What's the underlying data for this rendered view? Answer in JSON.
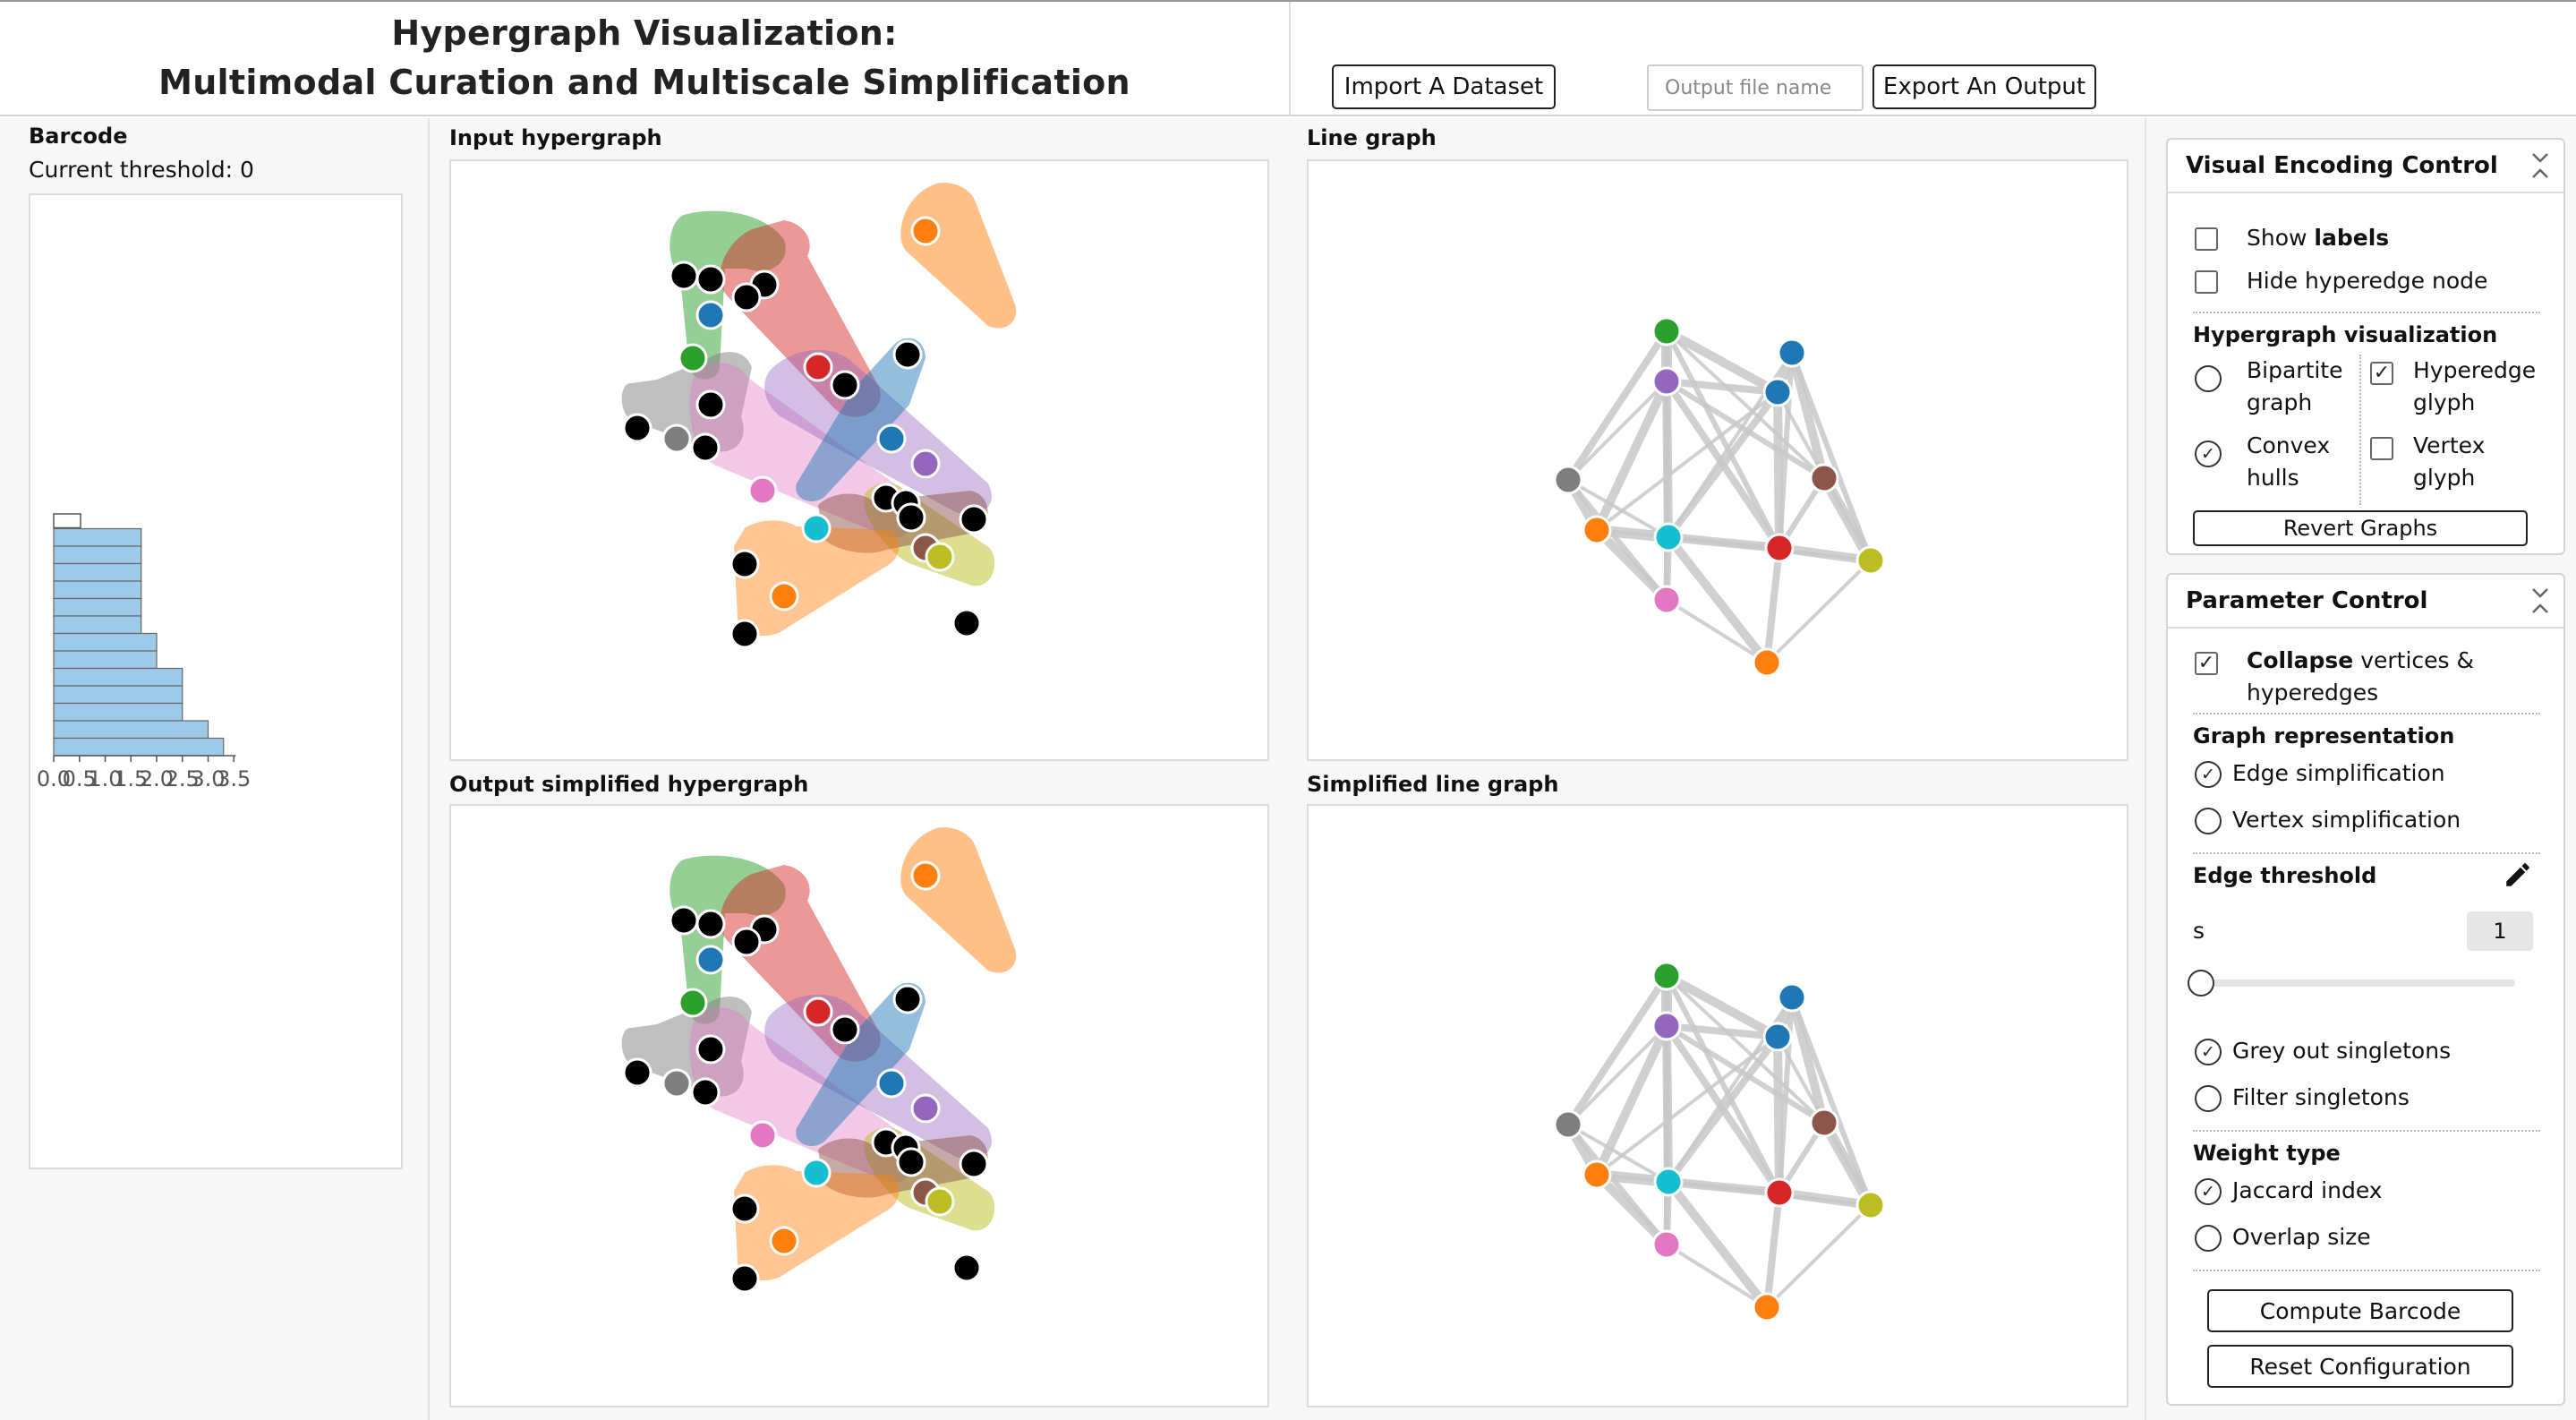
{
  "header": {
    "title_line1": "Hypergraph Visualization:",
    "title_line2": "Multimodal Curation and Multiscale Simplification",
    "import_label": "Import A Dataset",
    "output_placeholder": "Output file name",
    "export_label": "Export An Output"
  },
  "barcode": {
    "title": "Barcode",
    "threshold_text": "Current threshold: 0",
    "ticks": [
      "0.0",
      "0.5",
      "1.0",
      "1.5",
      "2.0",
      "2.5",
      "3.0",
      "3.5"
    ],
    "bars": [
      0.0,
      1.7,
      1.7,
      1.7,
      1.7,
      1.7,
      1.7,
      2.0,
      2.0,
      2.5,
      2.5,
      2.5,
      3.0,
      3.3
    ],
    "bar_color": "#9ecae9"
  },
  "panels": {
    "input_title": "Input hypergraph",
    "line_title": "Line graph",
    "output_title": "Output simplified hypergraph",
    "simplified_line_title": "Simplified line graph"
  },
  "colors": {
    "orange": "#ff7f0e",
    "red": "#d62728",
    "blue": "#1f77b4",
    "green": "#2ca02c",
    "purple": "#9467bd",
    "brown": "#8c564b",
    "pink": "#e377c2",
    "grey": "#7f7f7f",
    "olive": "#bcbd22",
    "cyan": "#17becf"
  },
  "visual_encoding": {
    "title": "Visual Encoding Control",
    "show_labels_pre": "Show ",
    "show_labels_bold": "labels",
    "hide_hyperedge_node": "Hide hyperedge node",
    "hypergraph_vis_title": "Hypergraph visualization",
    "bipartite_1": "Bipartite",
    "bipartite_2": "graph",
    "convex_1": "Convex",
    "convex_2": "hulls",
    "hyperedge_glyph_1": "Hyperedge",
    "hyperedge_glyph_2": "glyph",
    "vertex_glyph_1": "Vertex",
    "vertex_glyph_2": "glyph",
    "revert_label": "Revert Graphs"
  },
  "parameter": {
    "title": "Parameter Control",
    "collapse_bold": "Collapse",
    "collapse_rest": " vertices &",
    "collapse_line2": "hyperedges",
    "graph_rep_title": "Graph representation",
    "edge_simplification": "Edge simplification",
    "vertex_simplification": "Vertex simplification",
    "edge_threshold_title": "Edge threshold",
    "s_label": "s",
    "s_value": "1",
    "slider_value_fraction": 0.0,
    "grey_out": "Grey out singletons",
    "filter_singletons": "Filter singletons",
    "weight_type_title": "Weight type",
    "jaccard": "Jaccard index",
    "overlap": "Overlap size",
    "compute_label": "Compute Barcode",
    "reset_label": "Reset Configuration"
  }
}
